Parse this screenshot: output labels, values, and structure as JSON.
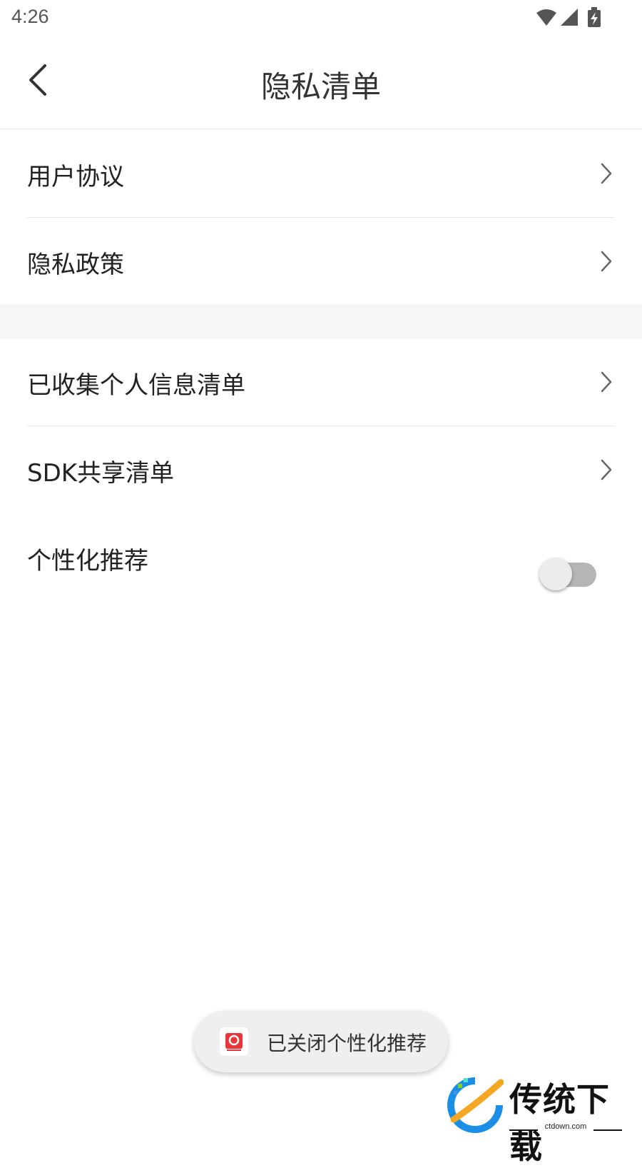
{
  "status_bar": {
    "time": "4:26",
    "icons": [
      "wifi-icon",
      "cellular-signal-icon",
      "battery-charging-icon"
    ]
  },
  "header": {
    "title": "隐私清单",
    "back_icon": "chevron-left-icon"
  },
  "menu_group_1": {
    "items": [
      {
        "label": "用户协议",
        "icon": "chevron-right-icon"
      },
      {
        "label": "隐私政策",
        "icon": "chevron-right-icon"
      }
    ]
  },
  "menu_group_2": {
    "items": [
      {
        "label": "已收集个人信息清单",
        "icon": "chevron-right-icon"
      },
      {
        "label": "SDK共享清单",
        "icon": "chevron-right-icon"
      }
    ]
  },
  "personalization": {
    "label": "个性化推荐",
    "enabled": false
  },
  "toast": {
    "text": "已关闭个性化推荐",
    "icon": "app-icon"
  },
  "watermark": {
    "title": "传统下载",
    "url": "ctdown.com"
  },
  "colors": {
    "switch_track_off": "#b5b5b5",
    "switch_thumb_off": "#ececec",
    "divider": "#e8e8e8",
    "section_gap": "#f6f6f6",
    "toast_bg": "#efeff2"
  }
}
